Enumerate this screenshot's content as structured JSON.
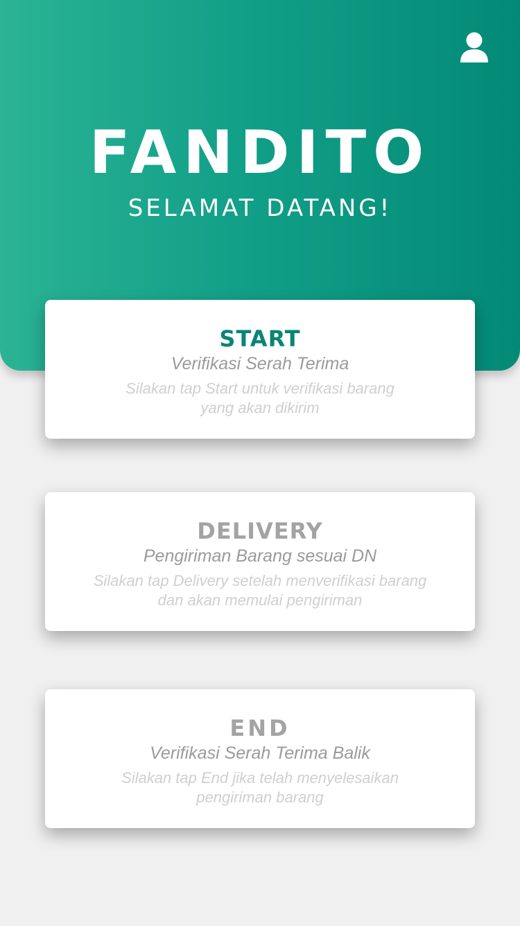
{
  "header": {
    "title": "FANDITO",
    "subtitle": "SELAMAT DATANG!",
    "profile_icon": "user-icon",
    "gradient": [
      "#2bb394",
      "#038a77"
    ]
  },
  "colors": {
    "background": "#f0f0f0",
    "accent": "#0a8575",
    "disabled_title": "#a3a3a3",
    "subtitle": "#9a9a9a",
    "description": "#cfcfcf"
  },
  "cards": [
    {
      "title": "START",
      "subtitle": "Verifikasi Serah Terima",
      "description": [
        "Silakan tap Start untuk verifikasi barang",
        "yang akan dikirim"
      ]
    },
    {
      "title": "DELIVERY",
      "subtitle": "Pengiriman Barang sesuai DN",
      "description": [
        "Silakan tap Delivery setelah menverifikasi barang",
        "dan akan memulai pengiriman"
      ]
    },
    {
      "title": "END",
      "subtitle": "Verifikasi Serah Terima Balik",
      "description": [
        "Silakan tap End jika telah menyelesaikan",
        "pengiriman barang"
      ]
    }
  ]
}
